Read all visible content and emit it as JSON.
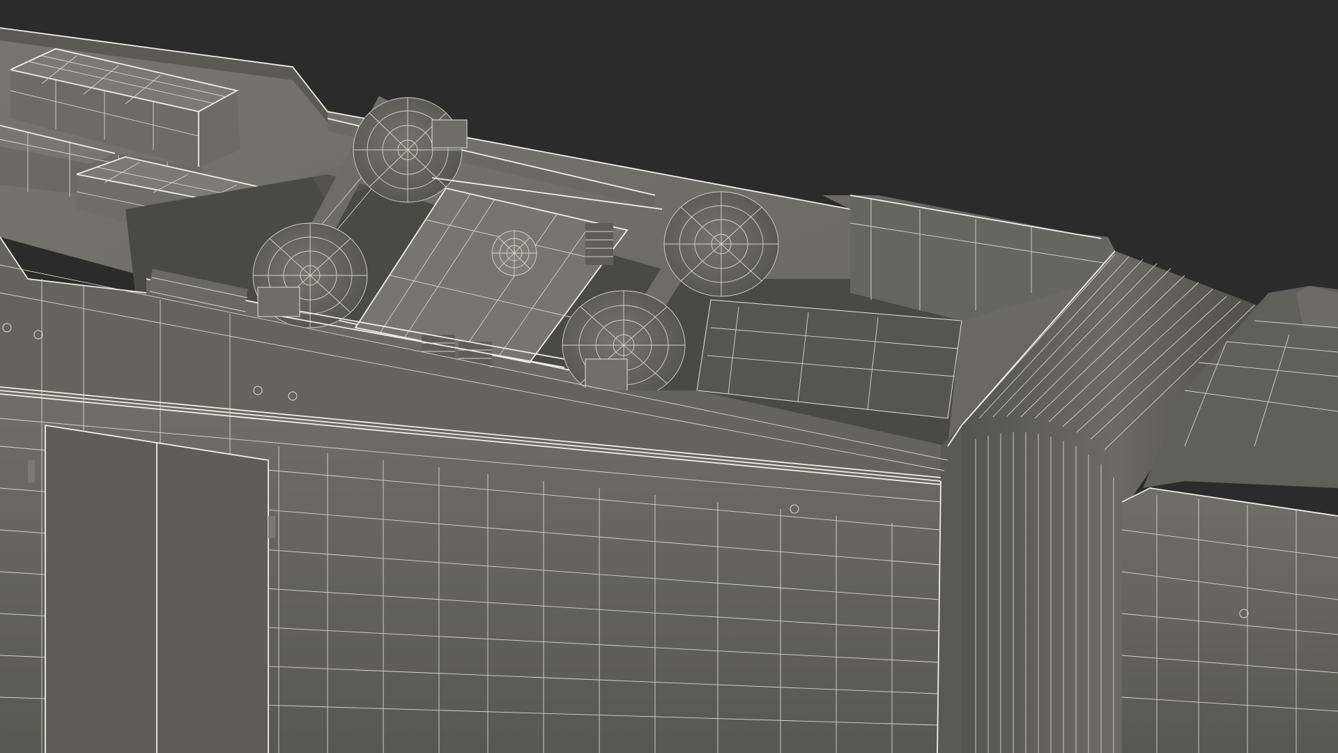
{
  "scene": {
    "subject": "railcar-underframe-wireframe",
    "colors": {
      "background": "#2b2b2b",
      "surface_light": "#6e6e66",
      "surface_mid": "#5f5f58",
      "surface_dark": "#4b4b45",
      "recess": "#3e3e39",
      "wire": "#e4e2d6"
    }
  }
}
